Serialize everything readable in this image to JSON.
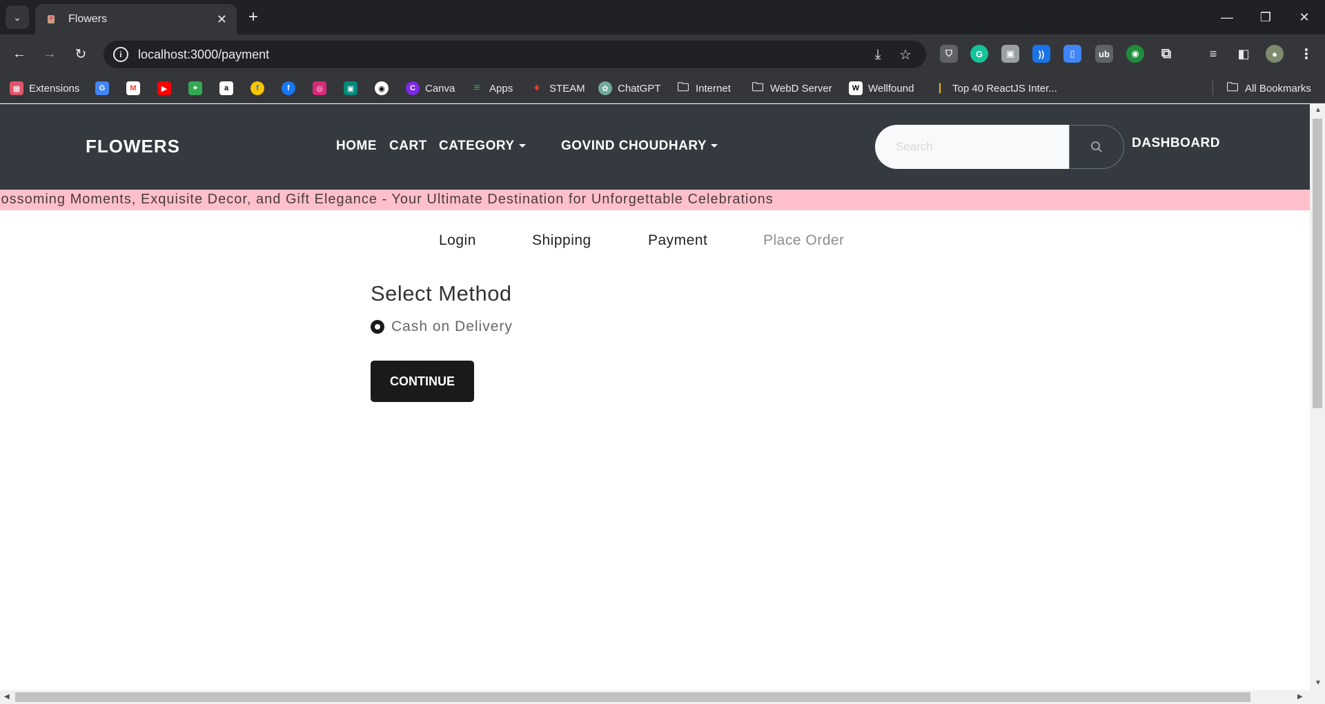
{
  "browser": {
    "tab_title": "Flowers",
    "url": "localhost:3000/payment",
    "new_tab": "+",
    "close_tab": "✕",
    "bookmarks": [
      "Extensions",
      "Canva",
      "Apps",
      "STEAM",
      "ChatGPT",
      "Internet",
      "WebD Server",
      "Wellfound",
      "Top 40 ReactJS Inter...",
      "All Bookmarks"
    ]
  },
  "header": {
    "brand": "FLOWERS",
    "nav": {
      "home": "HOME",
      "cart": "CART",
      "category": "CATEGORY",
      "user": "GOVIND CHOUDHARY"
    },
    "search_placeholder": "Search",
    "dashboard": "DASHBOARD"
  },
  "banner": {
    "text": "lossoming Moments, Exquisite Decor, and Gift Elegance - Your Ultimate Destination for Unforgettable Celebrations"
  },
  "checkout_steps": [
    "Login",
    "Shipping",
    "Payment",
    "Place Order"
  ],
  "payment": {
    "title": "Select Method",
    "method_label": "Cash on Delivery",
    "continue_label": "CONTINUE"
  },
  "colors": {
    "navbar_bg": "#343a40",
    "banner_bg": "#ffc0cb",
    "button_bg": "#1a1a1a",
    "chrome_dark": "#202124",
    "chrome_mid": "#35363a"
  }
}
